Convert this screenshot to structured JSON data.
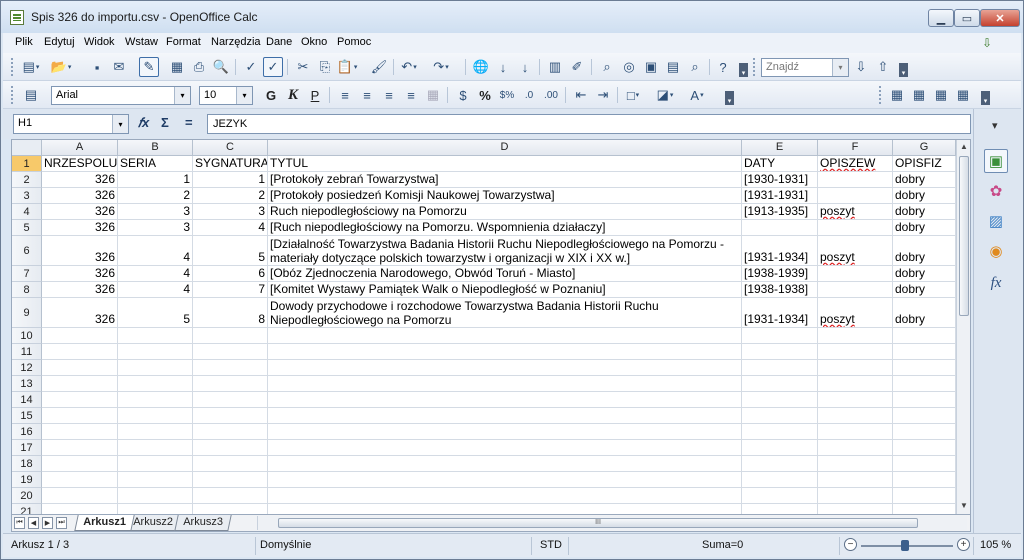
{
  "window": {
    "title": "Spis 326 do importu.csv - OpenOffice Calc",
    "min_glyph": "▁",
    "max_glyph": "▭",
    "close_glyph": "✕"
  },
  "menu": [
    "Plik",
    "Edytuj",
    "Widok",
    "Wstaw",
    "Format",
    "Narzędzia",
    "Dane",
    "Okno",
    "Pomoc"
  ],
  "toolbar": {
    "find_placeholder": "Znajdź",
    "font_name": "Arial",
    "font_size": "10",
    "bold": "G",
    "italic": "K",
    "underline": "P",
    "percent": "%"
  },
  "formula_bar": {
    "cell_ref": "H1",
    "fx": "𝑓x",
    "sigma": "Σ",
    "equals": "=",
    "content": "JEZYK"
  },
  "sheet": {
    "columns": [
      "A",
      "B",
      "C",
      "D",
      "E",
      "F",
      "G"
    ],
    "rows": [
      [
        "NRZESPOLU",
        "SERIA",
        "SYGNATURA",
        "TYTUL",
        "DATY",
        "OPISZEW",
        "OPISFIZ"
      ],
      [
        "326",
        "1",
        "1",
        "[Protokoły zebrań Towarzystwa]",
        "[1930-1931]",
        "",
        "dobry"
      ],
      [
        "326",
        "2",
        "2",
        "[Protokoły posiedzeń Komisji Naukowej Towarzystwa]",
        "[1931-1931]",
        "",
        "dobry"
      ],
      [
        "326",
        "3",
        "3",
        "Ruch niepodległościowy na Pomorzu",
        "[1913-1935]",
        "poszyt",
        "dobry"
      ],
      [
        "326",
        "3",
        "4",
        "[Ruch niepodległościowy na Pomorzu. Wspomnienia działaczy]",
        "",
        "",
        "dobry"
      ],
      [
        "326",
        "4",
        "5",
        "[Działalność Towarzystwa Badania Historii Ruchu Niepodległościowego na Pomorzu - materiały dotyczące polskich towarzystw i organizacji w XIX i XX w.]",
        "[1931-1934]",
        "poszyt",
        "dobry"
      ],
      [
        "326",
        "4",
        "6",
        "[Obóz Zjednoczenia Narodowego, Obwód Toruń - Miasto]",
        "[1938-1939]",
        "",
        "dobry"
      ],
      [
        "326",
        "4",
        "7",
        "[Komitet Wystawy Pamiątek Walk o Niepodległość w Poznaniu]",
        "[1938-1938]",
        "",
        "dobry"
      ],
      [
        "326",
        "5",
        "8",
        "Dowody przychodowe i rozchodowe Towarzystwa Badania Historii Ruchu Niepodległościowego na Pomorzu",
        "[1931-1934]",
        "poszyt",
        "dobry"
      ],
      [
        "",
        "",
        "",
        "",
        "",
        "",
        ""
      ],
      [
        "",
        "",
        "",
        "",
        "",
        "",
        ""
      ],
      [
        "",
        "",
        "",
        "",
        "",
        "",
        ""
      ],
      [
        "",
        "",
        "",
        "",
        "",
        "",
        ""
      ],
      [
        "",
        "",
        "",
        "",
        "",
        "",
        ""
      ],
      [
        "",
        "",
        "",
        "",
        "",
        "",
        ""
      ],
      [
        "",
        "",
        "",
        "",
        "",
        "",
        ""
      ],
      [
        "",
        "",
        "",
        "",
        "",
        "",
        ""
      ],
      [
        "",
        "",
        "",
        "",
        "",
        "",
        ""
      ],
      [
        "",
        "",
        "",
        "",
        "",
        "",
        ""
      ],
      [
        "",
        "",
        "",
        "",
        "",
        "",
        ""
      ],
      [
        "",
        "",
        "",
        "",
        "",
        "",
        ""
      ]
    ],
    "row_numbers": [
      "1",
      "2",
      "3",
      "4",
      "5",
      "6",
      "7",
      "8",
      "9",
      "10",
      "11",
      "12",
      "13",
      "14",
      "15",
      "16",
      "17",
      "18",
      "19",
      "20",
      "21"
    ]
  },
  "tabs": [
    "Arkusz1",
    "Arkusz2",
    "Arkusz3"
  ],
  "hscroll_grip": "III",
  "status": {
    "sheet": "Arkusz 1 / 3",
    "style": "Domyślnie",
    "mode": "STD",
    "sum": "Suma=0",
    "zoom": "105 %",
    "zoom_minus": "−",
    "zoom_plus": "+"
  },
  "sidebar_top": "▾"
}
